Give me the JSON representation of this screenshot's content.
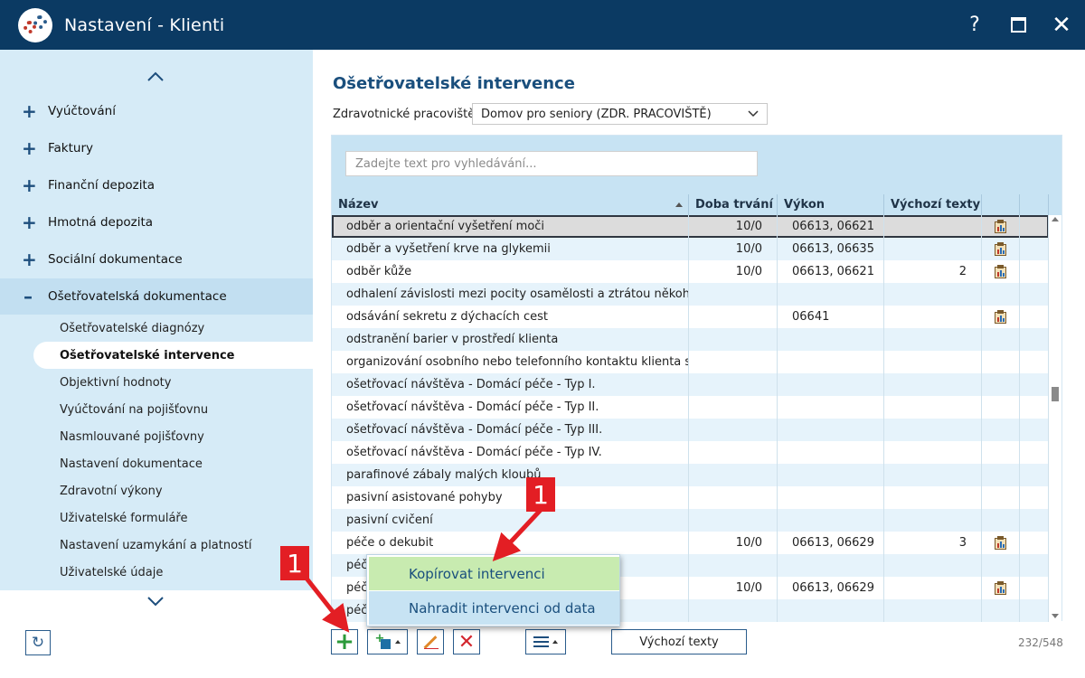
{
  "window": {
    "title": "Nastavení - Klienti",
    "help_glyph": "?",
    "close_glyph": "✕"
  },
  "sidebar": {
    "items": [
      {
        "label": "Vyúčtování"
      },
      {
        "label": "Faktury"
      },
      {
        "label": "Finanční depozita"
      },
      {
        "label": "Hmotná depozita"
      },
      {
        "label": "Sociální dokumentace"
      },
      {
        "label": "Ošetřovatelská dokumentace"
      }
    ],
    "subitems": [
      {
        "label": "Ošetřovatelské diagnózy"
      },
      {
        "label": "Ošetřovatelské intervence"
      },
      {
        "label": "Objektivní hodnoty"
      },
      {
        "label": "Vyúčtování na pojišťovnu"
      },
      {
        "label": "Nasmlouvané pojišťovny"
      },
      {
        "label": "Nastavení dokumentace"
      },
      {
        "label": "Zdravotní výkony"
      },
      {
        "label": "Uživatelské formuláře"
      },
      {
        "label": "Nastavení uzamykání a platností"
      },
      {
        "label": "Uživatelské údaje"
      }
    ]
  },
  "main": {
    "title": "Ošetřovatelské intervence",
    "workplace_label": "Zdravotnické pracoviště:",
    "workplace_value": "Domov pro seniory (ZDR. PRACOVIŠTĚ)",
    "search_placeholder": "Zadejte text pro vyhledávání...",
    "columns": {
      "name": "Název",
      "duration": "Doba trvání",
      "vykon": "Výkon",
      "texts": "Výchozí texty"
    },
    "rows": [
      {
        "name": "odběr a orientační vyšetření moči",
        "duration": "10/0",
        "vykon": "06613, 06621",
        "texts": "",
        "icon": true
      },
      {
        "name": "odběr a vyšetření krve na glykemii",
        "duration": "10/0",
        "vykon": "06613, 06635",
        "texts": "",
        "icon": true
      },
      {
        "name": "odběr kůže",
        "duration": "10/0",
        "vykon": "06613, 06621",
        "texts": "2",
        "icon": true
      },
      {
        "name": "odhalení závislosti mezi pocity osamělosti a ztrátou někoh...",
        "duration": "",
        "vykon": "",
        "texts": "",
        "icon": false
      },
      {
        "name": "odsávání sekretu z dýchacích cest",
        "duration": "",
        "vykon": "06641",
        "texts": "",
        "icon": true
      },
      {
        "name": "odstranění barier v prostředí klienta",
        "duration": "",
        "vykon": "",
        "texts": "",
        "icon": false
      },
      {
        "name": "organizování osobního nebo telefonního kontaktu klienta s...",
        "duration": "",
        "vykon": "",
        "texts": "",
        "icon": false
      },
      {
        "name": "ošetřovací návštěva - Domácí péče - Typ I.",
        "duration": "",
        "vykon": "",
        "texts": "",
        "icon": false
      },
      {
        "name": "ošetřovací návštěva - Domácí péče - Typ II.",
        "duration": "",
        "vykon": "",
        "texts": "",
        "icon": false
      },
      {
        "name": "ošetřovací návštěva - Domácí péče - Typ III.",
        "duration": "",
        "vykon": "",
        "texts": "",
        "icon": false
      },
      {
        "name": "ošetřovací návštěva - Domácí péče - Typ IV.",
        "duration": "",
        "vykon": "",
        "texts": "",
        "icon": false
      },
      {
        "name": "parafinové zábaly malých kloubů",
        "duration": "",
        "vykon": "",
        "texts": "",
        "icon": false
      },
      {
        "name": "pasivní asistované pohyby",
        "duration": "",
        "vykon": "",
        "texts": "",
        "icon": false
      },
      {
        "name": "pasivní cvičení",
        "duration": "",
        "vykon": "",
        "texts": "",
        "icon": false
      },
      {
        "name": "péče o dekubit",
        "duration": "10/0",
        "vykon": "06613, 06629",
        "texts": "3",
        "icon": true
      },
      {
        "name": "péč",
        "duration": "",
        "vykon": "",
        "texts": "",
        "icon": false
      },
      {
        "name": "péč",
        "duration": "10/0",
        "vykon": "06613, 06629",
        "texts": "",
        "icon": true
      },
      {
        "name": "péč",
        "duration": "",
        "vykon": "",
        "texts": "",
        "icon": false
      }
    ],
    "toolbar": {
      "default_texts_label": "Výchozí texty",
      "counter": "232/548"
    },
    "popup": {
      "items": [
        "Kopírovat intervenci",
        "Nahradit intervenci od data"
      ]
    },
    "badges": [
      "1",
      "1"
    ]
  },
  "colors": {
    "titlebar": "#0b3a63",
    "sidebar": "#d6ebf7",
    "accent": "#1a4f7d",
    "badge": "#e31e24"
  }
}
